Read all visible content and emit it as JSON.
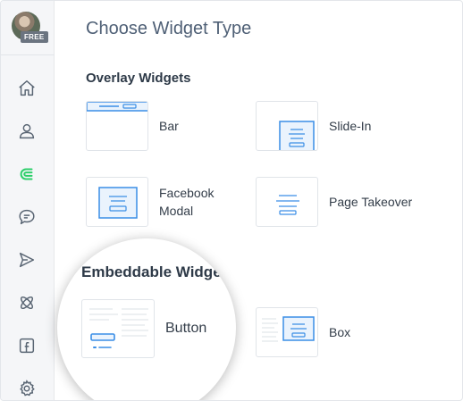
{
  "sidebar": {
    "badge": "FREE",
    "items": [
      {
        "icon": "home-icon"
      },
      {
        "icon": "user-icon"
      },
      {
        "icon": "magnet-icon",
        "active": true
      },
      {
        "icon": "chat-icon"
      },
      {
        "icon": "send-icon"
      },
      {
        "icon": "integrations-icon"
      },
      {
        "icon": "facebook-icon"
      },
      {
        "icon": "gear-icon"
      }
    ]
  },
  "main": {
    "title": "Choose Widget Type",
    "overlay_section": "Overlay Widgets",
    "overlay_widgets": [
      {
        "label": "Bar"
      },
      {
        "label": "Slide-In"
      },
      {
        "label": "Facebook Modal",
        "line1": "Facebook",
        "line2": "Modal"
      },
      {
        "label": "Page Takeover"
      }
    ],
    "embed_section": "Embeddable Widge",
    "embed_widgets": [
      {
        "label": "Button"
      },
      {
        "label": "Box"
      }
    ]
  },
  "colors": {
    "accent": "#3a8ee6",
    "active_nav": "#2ecf6b",
    "icon_gray": "#596573"
  }
}
